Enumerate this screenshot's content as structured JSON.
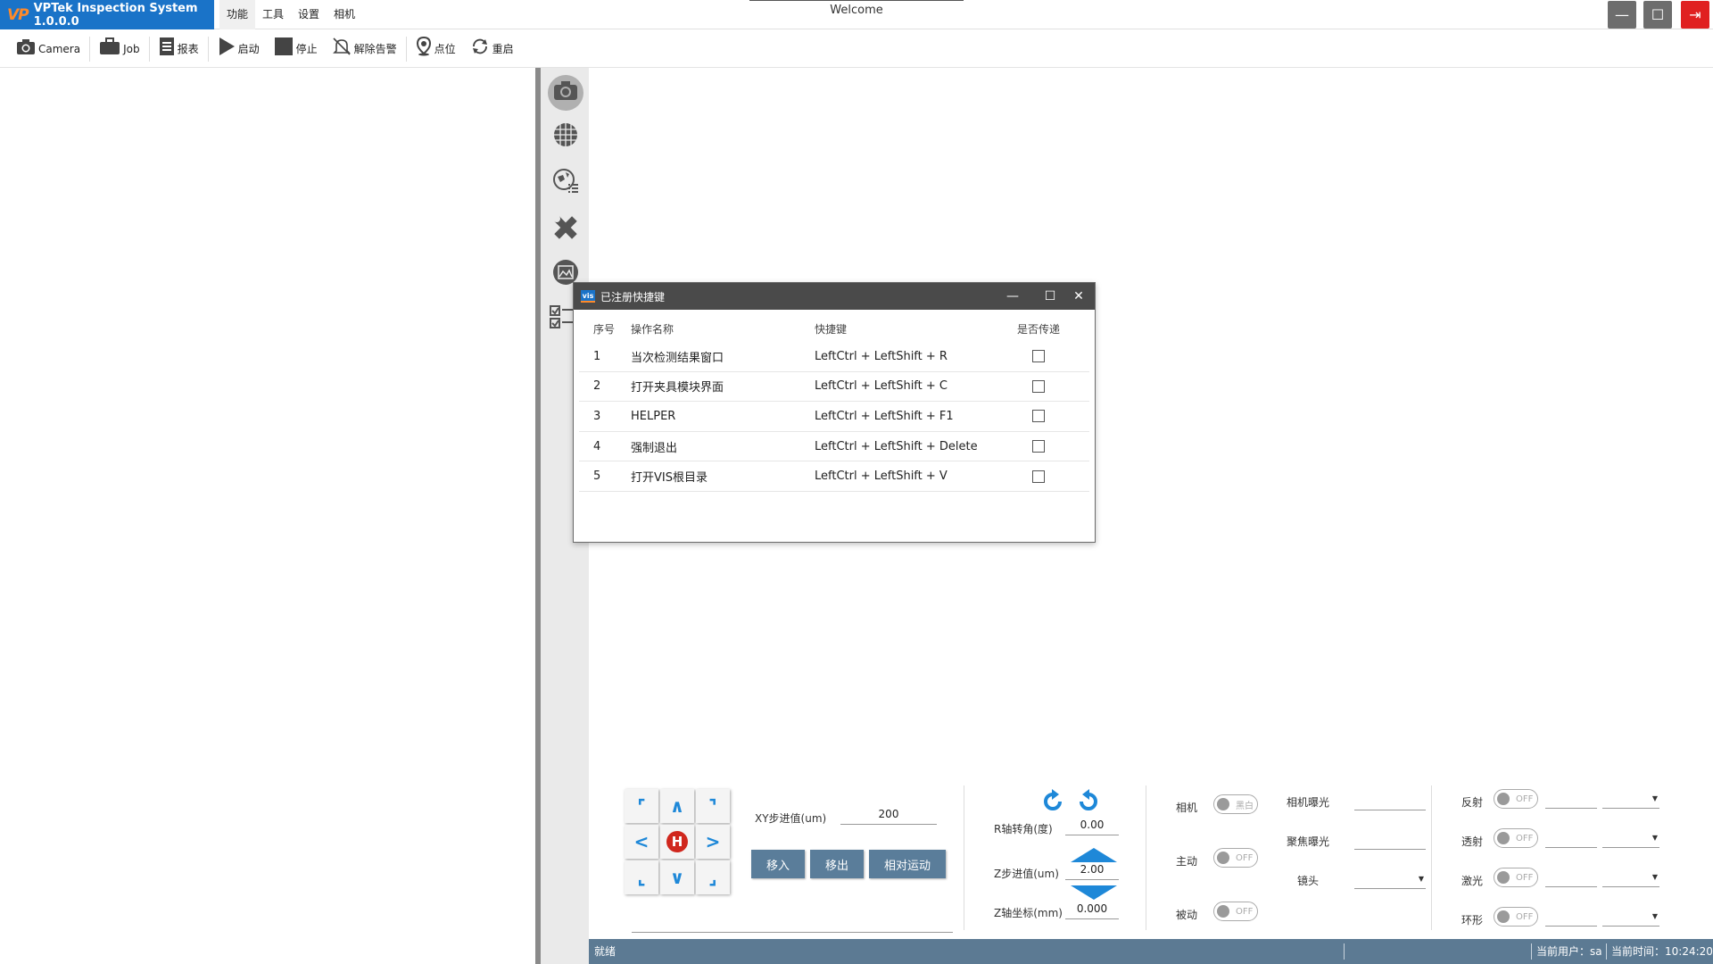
{
  "app": {
    "title": "VPTek Inspection System 1.0.0.0",
    "logo_text": "VP",
    "welcome": "Welcome",
    "menus": [
      "功能",
      "工具",
      "设置",
      "相机"
    ],
    "window_controls": {
      "minimize": "—",
      "maximize": "☐",
      "exit": "⇥"
    }
  },
  "toolbar": {
    "items": [
      {
        "label": "Camera",
        "icon": "camera-icon"
      },
      {
        "label": "Job",
        "icon": "briefcase-icon"
      },
      {
        "label": "报表",
        "icon": "report-icon"
      },
      {
        "label": "启动",
        "icon": "play-icon"
      },
      {
        "label": "停止",
        "icon": "stop-icon"
      },
      {
        "label": "解除告警",
        "icon": "bell-off-icon"
      },
      {
        "label": "点位",
        "icon": "location-pin-icon"
      },
      {
        "label": "重启",
        "icon": "restart-icon"
      }
    ]
  },
  "sidenav": {
    "icons": [
      "camera-icon",
      "grid-sphere-icon",
      "globe-list-icon",
      "tools-icon",
      "image-frame-icon",
      "checklist-icon"
    ]
  },
  "dialog": {
    "title": "已注册快捷键",
    "title_badge": "vis",
    "controls": {
      "minimize": "—",
      "maximize": "☐",
      "close": "✕"
    },
    "columns": [
      "序号",
      "操作名称",
      "快捷键",
      "是否传递"
    ],
    "rows": [
      {
        "no": "1",
        "name": "当次检测结果窗口",
        "shortcut": "LeftCtrl + LeftShift + R",
        "pass": false
      },
      {
        "no": "2",
        "name": "打开夹具模块界面",
        "shortcut": "LeftCtrl + LeftShift + C",
        "pass": false
      },
      {
        "no": "3",
        "name": "HELPER",
        "shortcut": "LeftCtrl + LeftShift + F1",
        "pass": false
      },
      {
        "no": "4",
        "name": "强制退出",
        "shortcut": "LeftCtrl + LeftShift + Delete",
        "pass": false
      },
      {
        "no": "5",
        "name": "打开VIS根目录",
        "shortcut": "LeftCtrl + LeftShift + V",
        "pass": false
      }
    ]
  },
  "motion": {
    "jog": {
      "up_left": "⌜",
      "up": "∧",
      "up_right": "⌝",
      "left": "<",
      "home": "H",
      "right": ">",
      "down_left": "⌞",
      "down": "∨",
      "down_right": "⌟"
    },
    "xy_step_label": "XY步进值(um)",
    "xy_step_value": "200",
    "buttons": [
      "移入",
      "移出",
      "相对运动"
    ],
    "r_angle_label": "R轴转角(度)",
    "r_angle_value": "0.00",
    "z_step_label": "Z步进值(um)",
    "z_step_value": "2.00",
    "z_coord_label": "Z轴坐标(mm)",
    "z_coord_value": "0.000"
  },
  "camera_panel": {
    "camera_label": "相机",
    "camera_toggle": "黑白",
    "active_label": "主动",
    "active_toggle": "OFF",
    "passive_label": "被动",
    "passive_toggle": "OFF",
    "exposure_label": "相机曝光",
    "focus_exposure_label": "聚焦曝光",
    "lens_label": "镜头"
  },
  "light_panel": {
    "items": [
      {
        "label": "反射",
        "toggle": "OFF"
      },
      {
        "label": "透射",
        "toggle": "OFF"
      },
      {
        "label": "激光",
        "toggle": "OFF"
      },
      {
        "label": "环形",
        "toggle": "OFF"
      }
    ]
  },
  "status": {
    "state": "就绪",
    "user_label": "当前用户：sa",
    "time_label": "当前时间：",
    "time_value": "10:24:20"
  }
}
